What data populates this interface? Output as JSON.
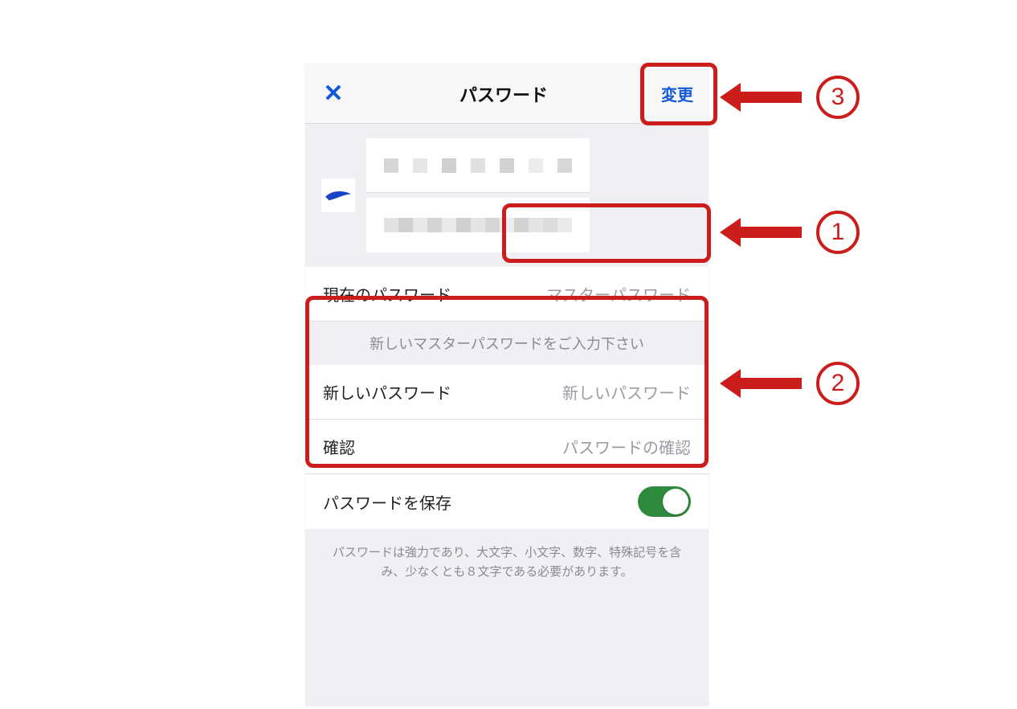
{
  "header": {
    "close_glyph": "✕",
    "title": "パスワード",
    "change_label": "変更"
  },
  "account": {
    "icon_name": "swallow-logo"
  },
  "current_pw": {
    "label": "現在のパスワード",
    "placeholder": "マスターパスワード"
  },
  "hint": "新しいマスターパスワードをご入力下さい",
  "new_pw": {
    "label": "新しいパスワード",
    "placeholder": "新しいパスワード"
  },
  "confirm_pw": {
    "label": "確認",
    "placeholder": "パスワードの確認"
  },
  "save_pw": {
    "label": "パスワードを保存",
    "on": true
  },
  "footer": "パスワードは強力であり、大文字、小文字、数字、特殊記号を含み、少なくとも８文字である必要があります。",
  "annotations": {
    "n1": "1",
    "n2": "2",
    "n3": "3"
  },
  "colors": {
    "accent_blue": "#1459d6",
    "highlight_red": "#cc1d1d",
    "toggle_green": "#2e8b3d"
  }
}
